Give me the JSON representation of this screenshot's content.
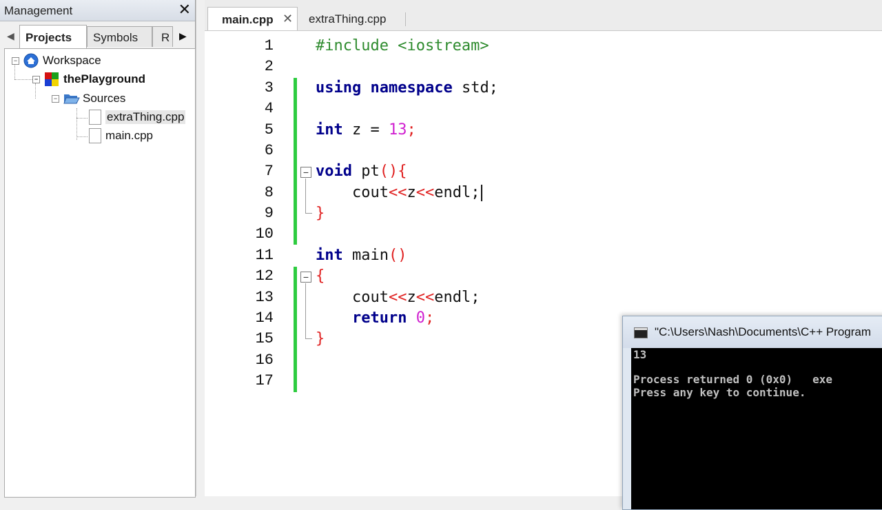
{
  "management": {
    "title": "Management",
    "close": "✕",
    "tabs": [
      "Projects",
      "Symbols",
      "R"
    ],
    "tree": {
      "workspace": "Workspace",
      "project": "thePlayground",
      "sources": "Sources",
      "files": [
        "extraThing.cpp",
        "main.cpp"
      ]
    }
  },
  "editor": {
    "tabs": [
      {
        "label": "main.cpp",
        "close": "✕"
      },
      {
        "label": "extraThing.cpp"
      }
    ],
    "line_numbers": [
      "1",
      "2",
      "3",
      "4",
      "5",
      "6",
      "7",
      "8",
      "9",
      "10",
      "11",
      "12",
      "13",
      "14",
      "15",
      "16",
      "17"
    ],
    "code": {
      "l1": "#include <iostream>",
      "l3a": "using",
      "l3b": "namespace",
      "l3c": " std;",
      "l5a": "int",
      "l5b": " z = ",
      "l5c": "13",
      "l5d": ";",
      "l7a": "void",
      "l7b": " pt",
      "l7c": "(){",
      "l8a": "    cout",
      "l8b": "<<",
      "l8c": "z",
      "l8d": "<<",
      "l8e": "endl;",
      "l9": "}",
      "l11a": "int",
      "l11b": " main",
      "l11c": "()",
      "l12": "{",
      "l13a": "    cout",
      "l13b": "<<",
      "l13c": "z",
      "l13d": "<<",
      "l13e": "endl;",
      "l14a": "    return",
      "l14b": " ",
      "l14c": "0",
      "l14d": ";",
      "l15": "}"
    }
  },
  "console": {
    "title": "\"C:\\Users\\Nash\\Documents\\C++ Program",
    "lines": [
      "13",
      "",
      "Process returned 0 (0x0)   exe",
      "Press any key to continue."
    ]
  },
  "colors": {
    "keyword": "#00008b",
    "preprocessor": "#2e8b2e",
    "number": "#d020d0",
    "operator": "#e02020",
    "changebar": "#2ecc40"
  }
}
